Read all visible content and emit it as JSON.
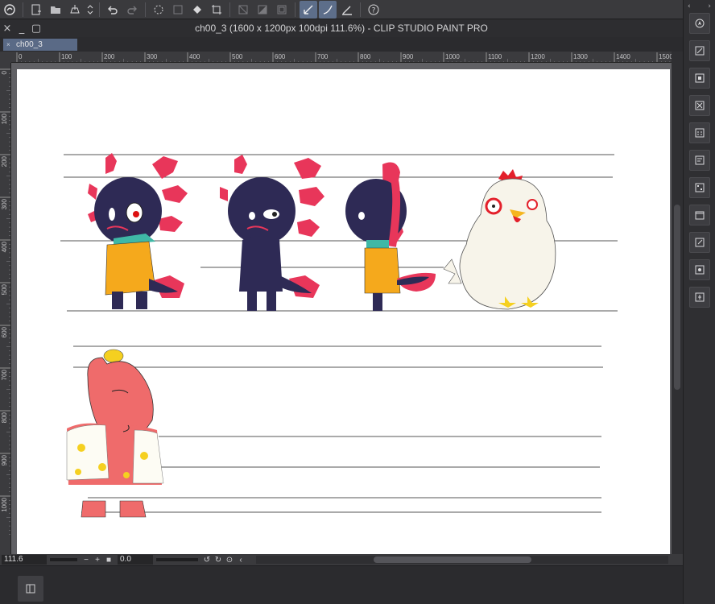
{
  "window": {
    "title": "ch00_3 (1600 x 1200px 100dpi 111.6%)  - CLIP STUDIO PAINT PRO",
    "tab_label": "ch00_3",
    "tab_close": "×"
  },
  "ruler": {
    "top_ticks": [
      "0",
      "100",
      "200",
      "300",
      "400",
      "500",
      "600",
      "700",
      "800",
      "900",
      "1000",
      "1100",
      "1200",
      "1300",
      "1400",
      "1500"
    ],
    "left_ticks": [
      "0",
      "100",
      "200",
      "300",
      "400",
      "500",
      "600",
      "700",
      "800",
      "900",
      "1000"
    ]
  },
  "status": {
    "zoom_value": "111.6",
    "rotation_value": "0.0",
    "zoom_out": "−",
    "zoom_in": "+"
  },
  "toolbar_icons": [
    "clip-studio-icon",
    "new-file-icon",
    "open-file-icon",
    "save-icon",
    "chevrons-icon",
    "undo-icon",
    "redo-icon",
    "loading-icon",
    "transform-icon",
    "fill-icon",
    "crop-icon",
    "clear-icon",
    "invert-icon",
    "border-icon",
    "snap-ruler-icon",
    "snap-special-ruler-icon",
    "snap-grid-icon",
    "help-icon"
  ],
  "right_panel_icons": [
    "navigator-icon",
    "sub-view-icon",
    "layer-property-icon",
    "layer-icon",
    "material-icon",
    "tool-property-icon",
    "color-set-icon",
    "history-icon",
    "auto-action-icon",
    "item-bank-icon",
    "animation-icon"
  ],
  "colors": {
    "panel_bg": "#2b2b2e",
    "active_tab": "#5a6a86",
    "paper": "#ffffff",
    "axolotl_body": "#2e2a55",
    "axolotl_gills": "#e8365a",
    "coat": "#f5a91c",
    "scarf": "#3fb8a6",
    "hippo_body": "#ef6b6b",
    "rooster_body": "#f7f4ea",
    "rooster_comb": "#e3202b"
  }
}
